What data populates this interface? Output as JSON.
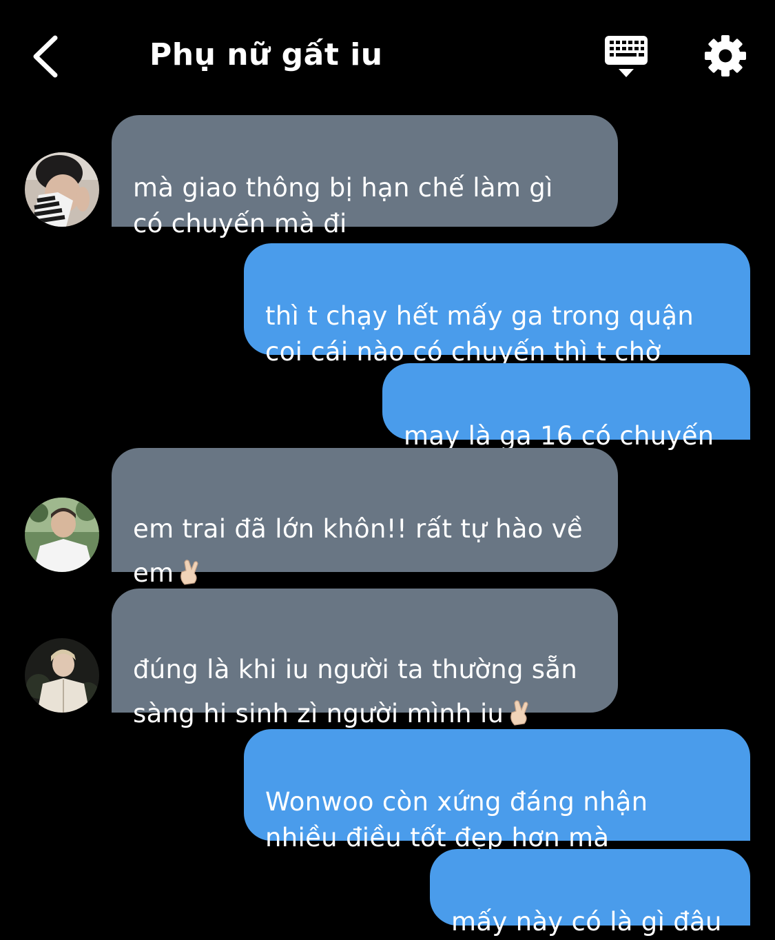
{
  "header": {
    "title": "Phụ nữ gất iu",
    "back_icon": "chevron-left-icon",
    "keyboard_icon": "keyboard-hide-icon",
    "settings_icon": "gear-icon"
  },
  "colors": {
    "background": "#000000",
    "incoming_bubble": "#697684",
    "outgoing_bubble": "#4a9ceb",
    "text": "#ffffff"
  },
  "messages": [
    {
      "direction": "incoming",
      "text": "mà giao thông bị hạn chế làm gì\ncó chuyến mà đi"
    },
    {
      "direction": "outgoing",
      "text": "thì t chạy hết mấy ga trong quận\ncoi cái nào có chuyến thì t chờ"
    },
    {
      "direction": "outgoing",
      "text": "may là ga 16 có chuyến"
    },
    {
      "direction": "incoming",
      "text": "em trai đã lớn khôn!! rất tự hào về\nem",
      "emoji": "crossed-fingers-emoji"
    },
    {
      "direction": "incoming",
      "text": "đúng là khi iu người ta thường sẵn\nsàng hi sinh zì người mình iu",
      "emoji": "crossed-fingers-emoji"
    },
    {
      "direction": "outgoing",
      "text": "Wonwoo còn xứng đáng nhận\nnhiều điều tốt đẹp hơn mà"
    },
    {
      "direction": "outgoing",
      "text": "mấy này có là gì đâu"
    }
  ]
}
